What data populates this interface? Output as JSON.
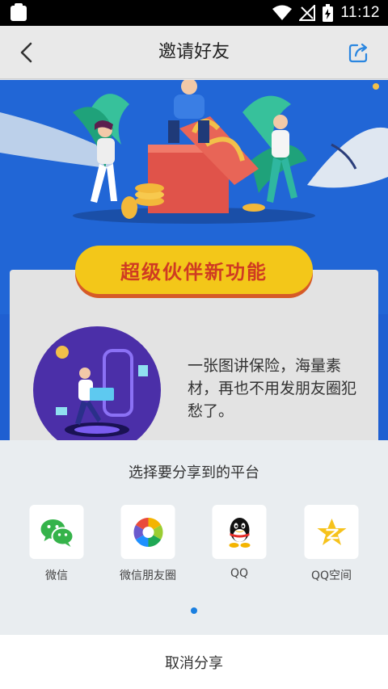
{
  "status_bar": {
    "time": "11:12",
    "icons": [
      "notification-icon",
      "wifi-icon",
      "no-signal-icon",
      "battery-charging-icon"
    ]
  },
  "header": {
    "title": "邀请好友",
    "back_icon": "chevron-left-icon",
    "share_icon": "share-export-icon"
  },
  "promo": {
    "badge": "超级伙伴新功能",
    "description": "一张图讲保险，海量素材，再也不用发朋友圈犯愁了。"
  },
  "share_sheet": {
    "title": "选择要分享到的平台",
    "platforms": [
      {
        "label": "微信",
        "icon": "wechat-icon"
      },
      {
        "label": "微信朋友圈",
        "icon": "wechat-moments-icon"
      },
      {
        "label": "QQ",
        "icon": "qq-icon"
      },
      {
        "label": "QQ空间",
        "icon": "qzone-icon"
      }
    ],
    "cancel_label": "取消分享"
  },
  "colors": {
    "accent": "#1a7fe0",
    "banner_blue": "#1f5fd1",
    "badge_yellow": "#f3c719",
    "badge_text": "#cf3b22"
  }
}
